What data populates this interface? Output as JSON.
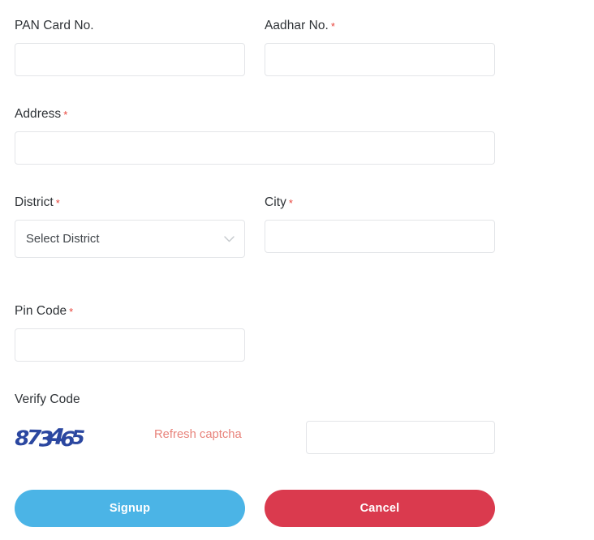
{
  "form": {
    "fields": {
      "pan": {
        "label": "PAN Card No.",
        "required": false,
        "value": "",
        "placeholder": ""
      },
      "aadhar": {
        "label": "Aadhar No.",
        "required": true,
        "required_marker": "*",
        "value": "",
        "placeholder": ""
      },
      "address": {
        "label": "Address",
        "required": true,
        "required_marker": "*",
        "value": "",
        "placeholder": ""
      },
      "district": {
        "label": "District",
        "required": true,
        "required_marker": "*",
        "selected": "Select District",
        "options": [
          "Select District"
        ],
        "chevron_icon": "chevron-down-icon"
      },
      "city": {
        "label": "City",
        "required": true,
        "required_marker": "*",
        "value": "",
        "placeholder": ""
      },
      "pincode": {
        "label": "Pin Code",
        "required": true,
        "required_marker": "*",
        "value": "",
        "placeholder": ""
      },
      "verify_code": {
        "label": "Verify Code",
        "required": false,
        "captcha_text": "873465",
        "captcha_digits": [
          "8",
          "7",
          "3",
          "4",
          "6",
          "5"
        ],
        "refresh_label": "Refresh captcha",
        "value": "",
        "placeholder": ""
      }
    },
    "actions": {
      "signup_label": "Signup",
      "cancel_label": "Cancel"
    }
  },
  "colors": {
    "label_text": "#2f3337",
    "required_star": "#e8453c",
    "input_border": "#e3e5e8",
    "captcha_digits": "#2b47a0",
    "refresh_link": "#e8837b",
    "signup_button": "#4bb4e6",
    "cancel_button": "#da3a4e",
    "page_background": "#ffffff"
  }
}
